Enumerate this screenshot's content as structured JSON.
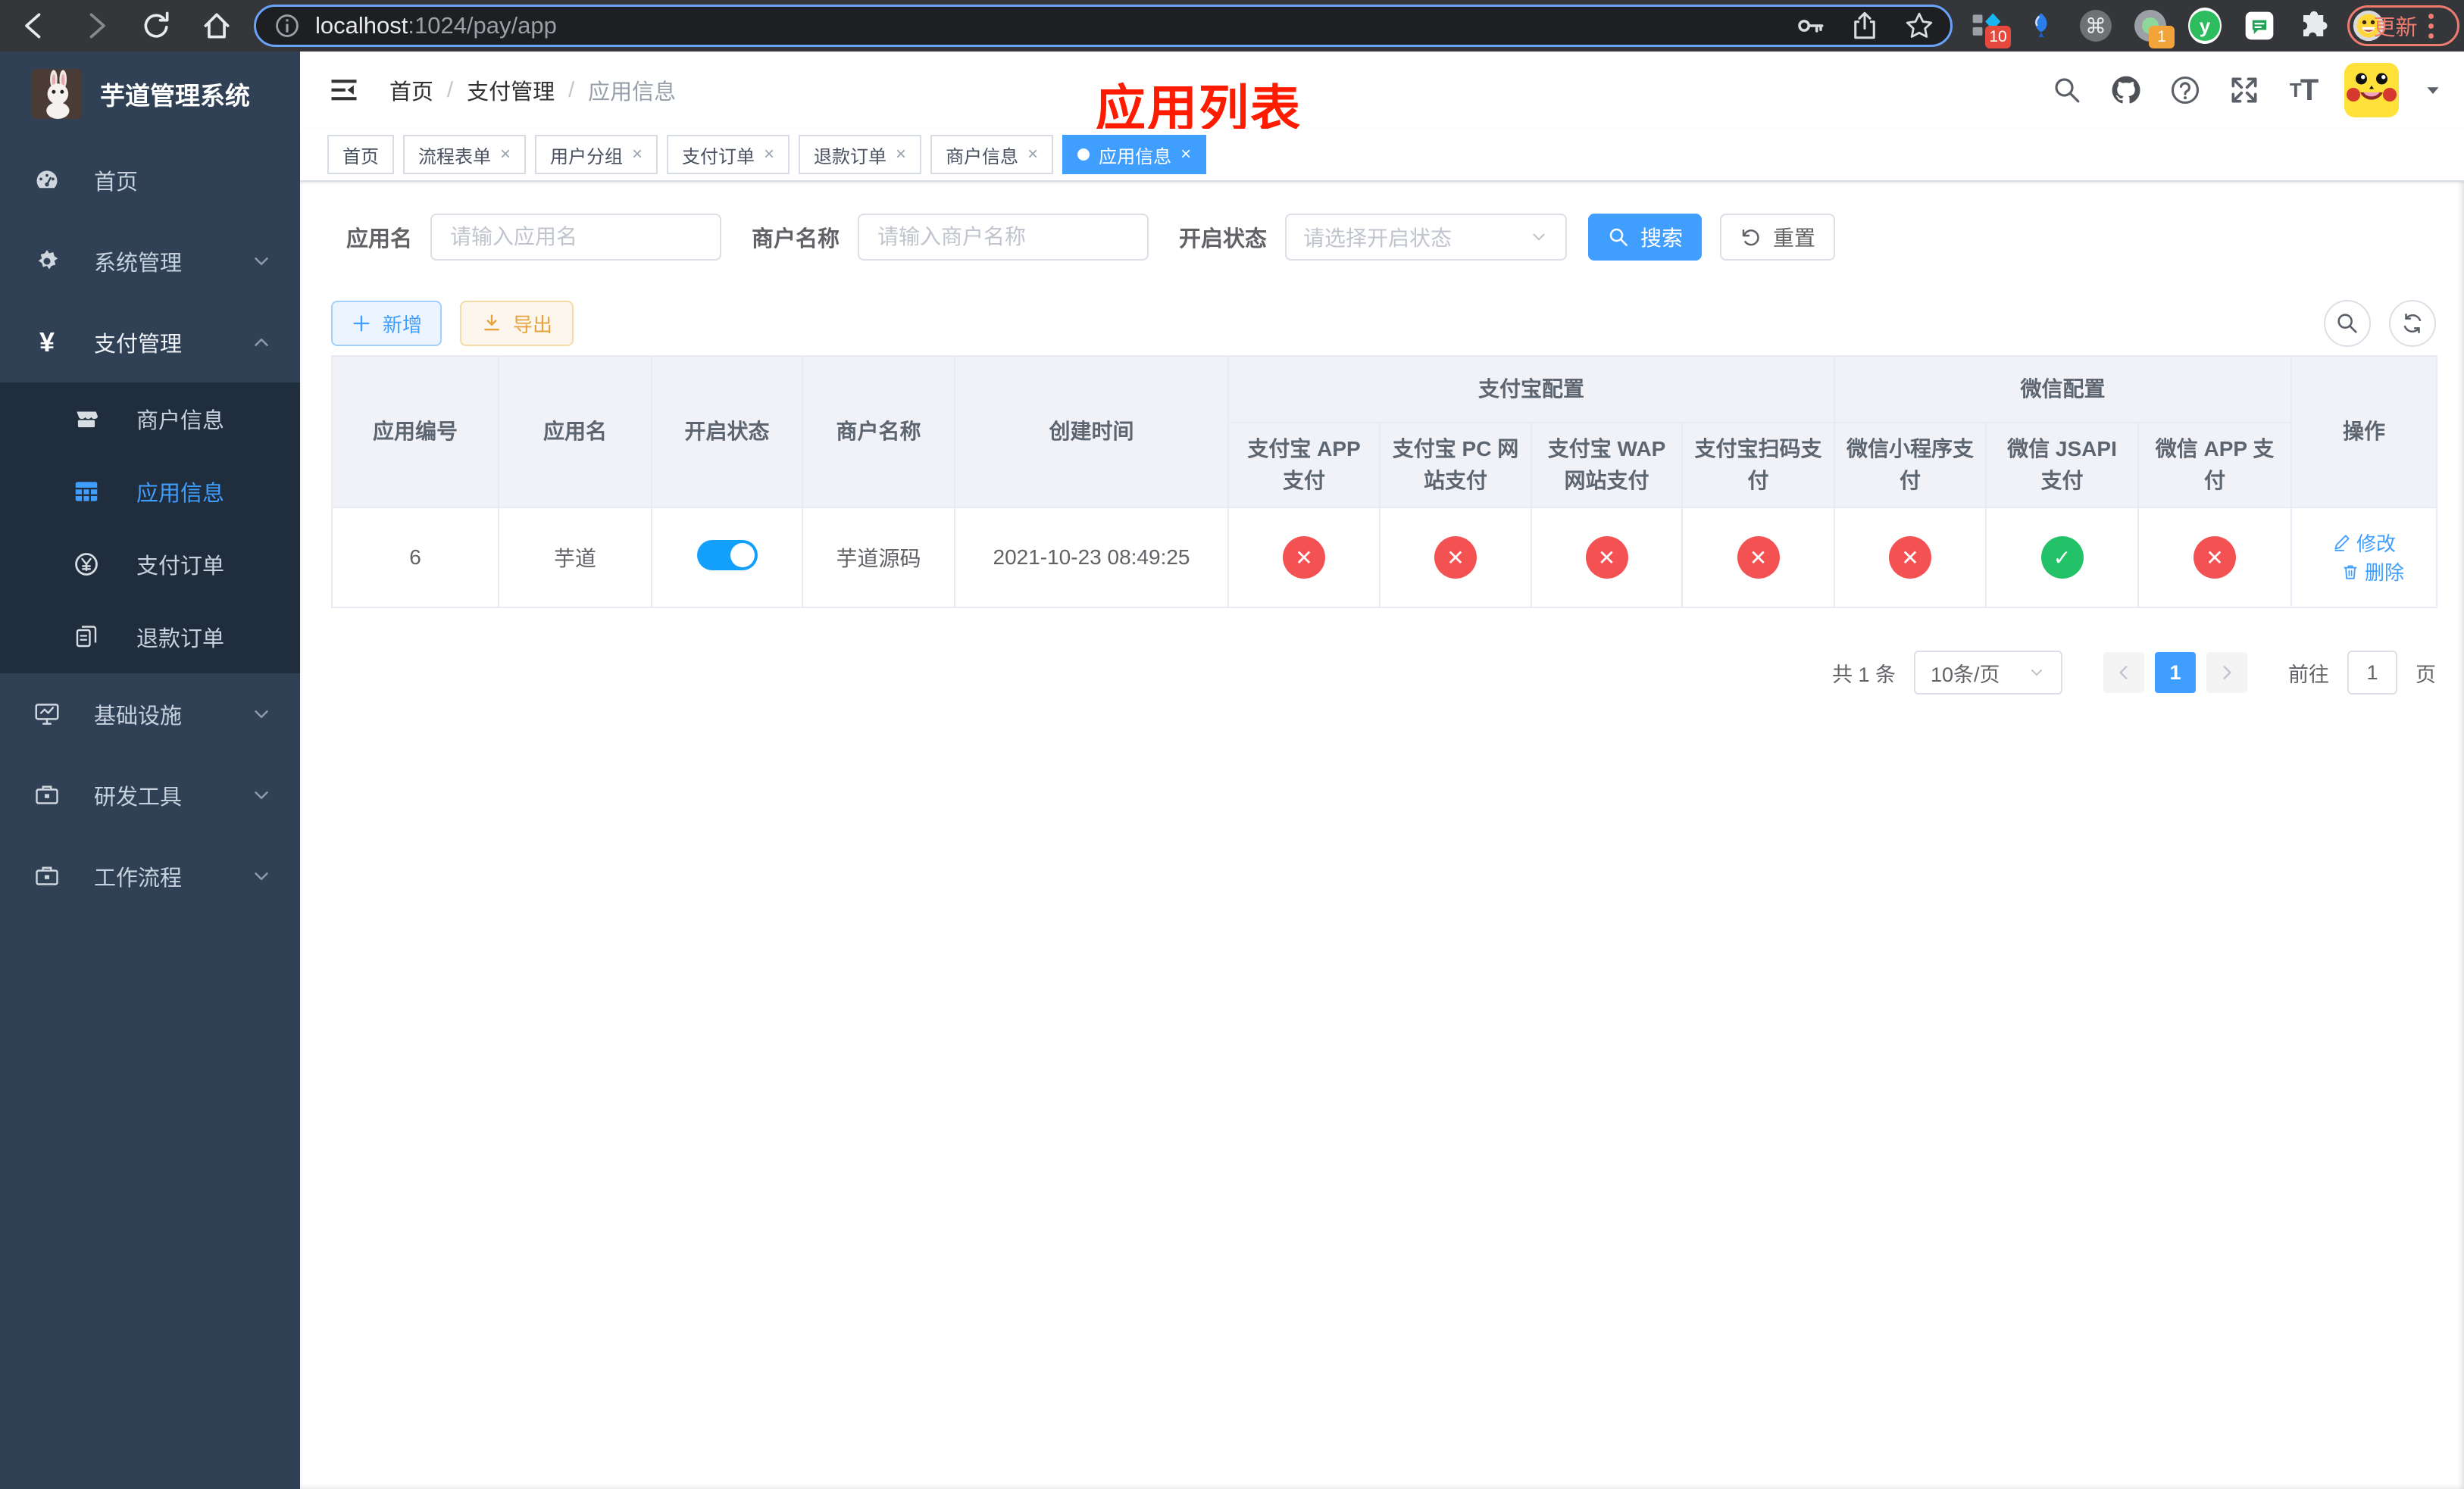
{
  "browser": {
    "url_host": "localhost",
    "url_rest": ":1024/pay/app",
    "update_label": "更新",
    "ext_badge_diamond": "10",
    "ext_badge_record": "1",
    "ext_y_label": "y",
    "ext_cmd_glyph": "⌘"
  },
  "sidebar": {
    "title": "芋道管理系统",
    "items": [
      {
        "label": "首页"
      },
      {
        "label": "系统管理"
      },
      {
        "label": "支付管理"
      }
    ],
    "submenu": [
      {
        "label": "商户信息"
      },
      {
        "label": "应用信息"
      },
      {
        "label": "支付订单"
      },
      {
        "label": "退款订单"
      }
    ],
    "items2": [
      {
        "label": "基础设施"
      },
      {
        "label": "研发工具"
      },
      {
        "label": "工作流程"
      }
    ]
  },
  "navbar": {
    "breadcrumb": [
      "首页",
      "支付管理",
      "应用信息"
    ],
    "annotation": "应用列表"
  },
  "tabs": [
    {
      "label": "首页"
    },
    {
      "label": "流程表单"
    },
    {
      "label": "用户分组"
    },
    {
      "label": "支付订单"
    },
    {
      "label": "退款订单"
    },
    {
      "label": "商户信息"
    },
    {
      "label": "应用信息"
    }
  ],
  "filter": {
    "app_name_label": "应用名",
    "app_name_placeholder": "请输入应用名",
    "merchant_label": "商户名称",
    "merchant_placeholder": "请输入商户名称",
    "status_label": "开启状态",
    "status_placeholder": "请选择开启状态",
    "search_label": "搜索",
    "reset_label": "重置"
  },
  "toolbar": {
    "add_label": "新增",
    "export_label": "导出"
  },
  "table": {
    "headers": {
      "app_id": "应用编号",
      "app_name": "应用名",
      "status": "开启状态",
      "merchant": "商户名称",
      "created": "创建时间",
      "alipay_group": "支付宝配置",
      "wechat_group": "微信配置",
      "actions": "操作"
    },
    "sub_headers": [
      "支付宝 APP 支付",
      "支付宝 PC 网站支付",
      "支付宝 WAP 网站支付",
      "支付宝扫码支付",
      "微信小程序支付",
      "微信 JSAPI 支付",
      "微信 APP 支付"
    ],
    "row": {
      "app_id": "6",
      "app_name": "芋道",
      "enabled": true,
      "merchant": "芋道源码",
      "created": "2021-10-23 08:49:25",
      "channels": [
        false,
        false,
        false,
        false,
        false,
        true,
        false
      ],
      "edit_label": "修改",
      "delete_label": "删除"
    }
  },
  "pagination": {
    "total": "共 1 条",
    "page_size": "10条/页",
    "current_page": "1",
    "goto_label": "前往",
    "goto_value": "1",
    "page_suffix": "页"
  },
  "ui": {
    "close_glyph": "×",
    "check_glyph": "✓",
    "cross_glyph": "✕",
    "sep": "/"
  }
}
